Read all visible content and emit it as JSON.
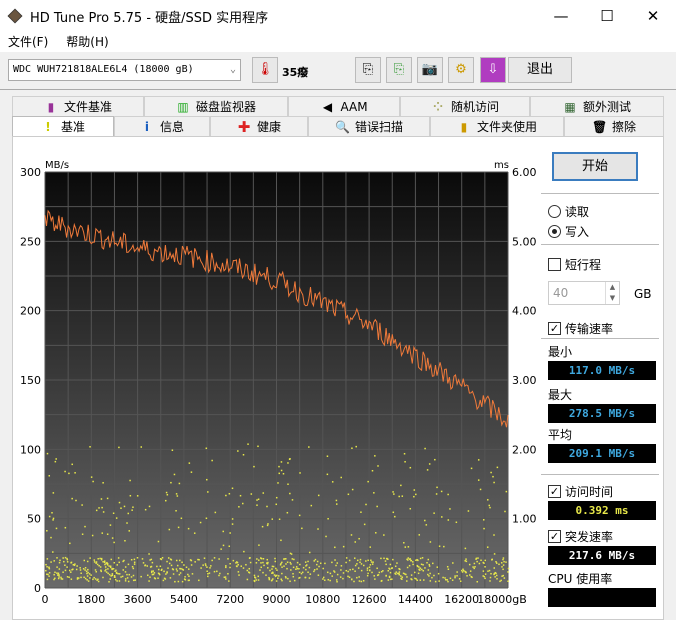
{
  "window": {
    "title": "HD Tune Pro 5.75 - 硬盘/SSD 实用程序",
    "minimize": "—",
    "maximize": "☐",
    "close": "✕"
  },
  "menu": [
    "文件(F)",
    "帮助(H)"
  ],
  "toolbar": {
    "drive": "WDC  WUH721818ALE6L4 (18000 gB)",
    "temperature": "35癈",
    "exit": "退出"
  },
  "tabs_row1": [
    "文件基准",
    "磁盘监视器",
    "AAM",
    "随机访问",
    "额外测试"
  ],
  "tabs_row2": [
    "基准",
    "信息",
    "健康",
    "错误扫描",
    "文件夹使用",
    "擦除"
  ],
  "controls": {
    "start": "开始",
    "read": "读取",
    "write": "写入",
    "mode": "write",
    "short_stroke": "短行程",
    "short_stroke_checked": false,
    "short_value": "40",
    "gb": "GB",
    "transfer_rate": "传输速率",
    "transfer_checked": true,
    "min_label": "最小",
    "min": "117.0 MB/s",
    "max_label": "最大",
    "max": "278.5 MB/s",
    "avg_label": "平均",
    "avg": "209.1 MB/s",
    "access_label": "访问时间",
    "access_checked": true,
    "access": "0.392 ms",
    "burst_label": "突发速率",
    "burst_checked": true,
    "burst": "217.6 MB/s",
    "cpu_label": "CPU 使用率"
  },
  "colors": {
    "speed": "#f07a3a",
    "access": "#e8e84a",
    "value": "#3fa9e0"
  },
  "chart_data": {
    "type": "line",
    "ylabel": "MB/s",
    "y2label": "ms",
    "xunit": "gB",
    "xlim": [
      0,
      18000
    ],
    "ylim": [
      0,
      300
    ],
    "y2lim": [
      0,
      6
    ],
    "xticks": [
      "0",
      "1800",
      "3600",
      "5400",
      "7200",
      "9000",
      "10800",
      "12600",
      "14400",
      "16200",
      "18000gB"
    ],
    "yticks": [
      "0",
      "50",
      "100",
      "150",
      "200",
      "250",
      "300"
    ],
    "y2ticks": [
      "1.00",
      "2.00",
      "3.00",
      "4.00",
      "5.00",
      "6.00"
    ],
    "series": [
      {
        "name": "transfer rate (MB/s)",
        "x": [
          0,
          1800,
          3600,
          5400,
          7200,
          9000,
          10800,
          12600,
          14400,
          16200,
          18000
        ],
        "values": [
          265,
          255,
          245,
          240,
          232,
          222,
          205,
          190,
          168,
          145,
          120
        ]
      },
      {
        "name": "access time (ms)",
        "type": "scatter",
        "description_values": [
          0.15,
          0.25,
          0.4,
          1.0,
          1.5
        ]
      }
    ]
  }
}
